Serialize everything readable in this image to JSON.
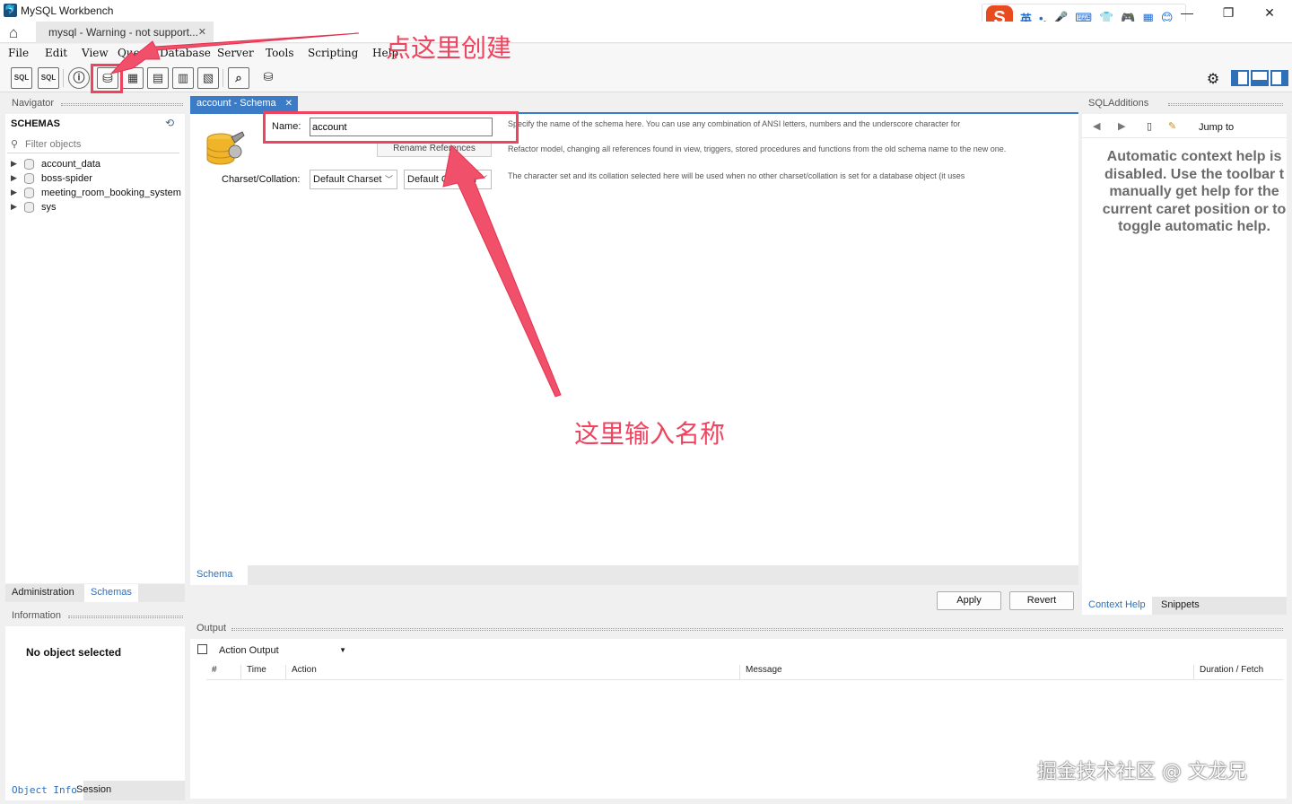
{
  "window": {
    "title": "MySQL Workbench",
    "minimize": "—",
    "restore": "❐",
    "close": "✕"
  },
  "ime": {
    "logo": "S",
    "mode": "英",
    "icons": [
      "•,",
      "🎤",
      "⌨",
      "👕",
      "🎮",
      "▦",
      "😊"
    ]
  },
  "tabs": {
    "home_icon": "home-icon",
    "connection_tab": {
      "label": "mysql - Warning - not support...",
      "close": "✕"
    }
  },
  "menu": [
    "File",
    "Edit",
    "View",
    "Query",
    "Database",
    "Server",
    "Tools",
    "Scripting",
    "Help"
  ],
  "toolbar": {
    "buttons": [
      "new-sql-tab",
      "open-sql-script",
      "schema-inspector",
      "create-schema",
      "create-table",
      "create-view",
      "create-procedure",
      "create-function",
      "search-table-data",
      "reconnect"
    ],
    "sql_label": "SQL"
  },
  "navigator": {
    "header": "Navigator",
    "schemas_title": "SCHEMAS",
    "filter_placeholder": "Filter objects",
    "schemas": [
      "account_data",
      "boss-spider",
      "meeting_room_booking_system",
      "sys"
    ],
    "bottom_tabs": [
      "Administration",
      "Schemas"
    ]
  },
  "information": {
    "header": "Information",
    "empty_text": "No object selected",
    "tabs": [
      "Object Info",
      "Session"
    ]
  },
  "editor": {
    "tab_label": "account - Schema",
    "tab_close": "✕",
    "name_label": "Name:",
    "name_value": "account",
    "rename_button": "Rename References",
    "charset_label": "Charset/Collation:",
    "charset_value": "Default Charset",
    "collation_value": "Default Collation",
    "help_name": "Specify the name of the schema here. You can use any combination of ANSI letters, numbers and the underscore character for",
    "help_rename": "Refactor model, changing all references found in view, triggers, stored procedures and functions from the old schema name to the new one.",
    "help_charset": "The character set and its collation selected here will be used when no other charset/collation is set for a database object (it uses",
    "subtab": "Schema",
    "apply": "Apply",
    "revert": "Revert"
  },
  "output": {
    "header": "Output",
    "select_value": "Action Output",
    "columns": [
      "#",
      "Time",
      "Action",
      "Message",
      "Duration / Fetch"
    ]
  },
  "sqladditions": {
    "header": "SQLAdditions",
    "jump_to": "Jump to",
    "context_message": "Automatic context help is\ndisabled. Use the toolbar t\nmanually get help for the\ncurrent caret position or to\ntoggle automatic help.",
    "tabs": [
      "Context Help",
      "Snippets"
    ]
  },
  "annotations": {
    "create_hint": "点这里创建",
    "name_hint": "这里输入名称",
    "accent_color": "#ee4460"
  },
  "watermark": "掘金技术社区 @ 文龙兄"
}
